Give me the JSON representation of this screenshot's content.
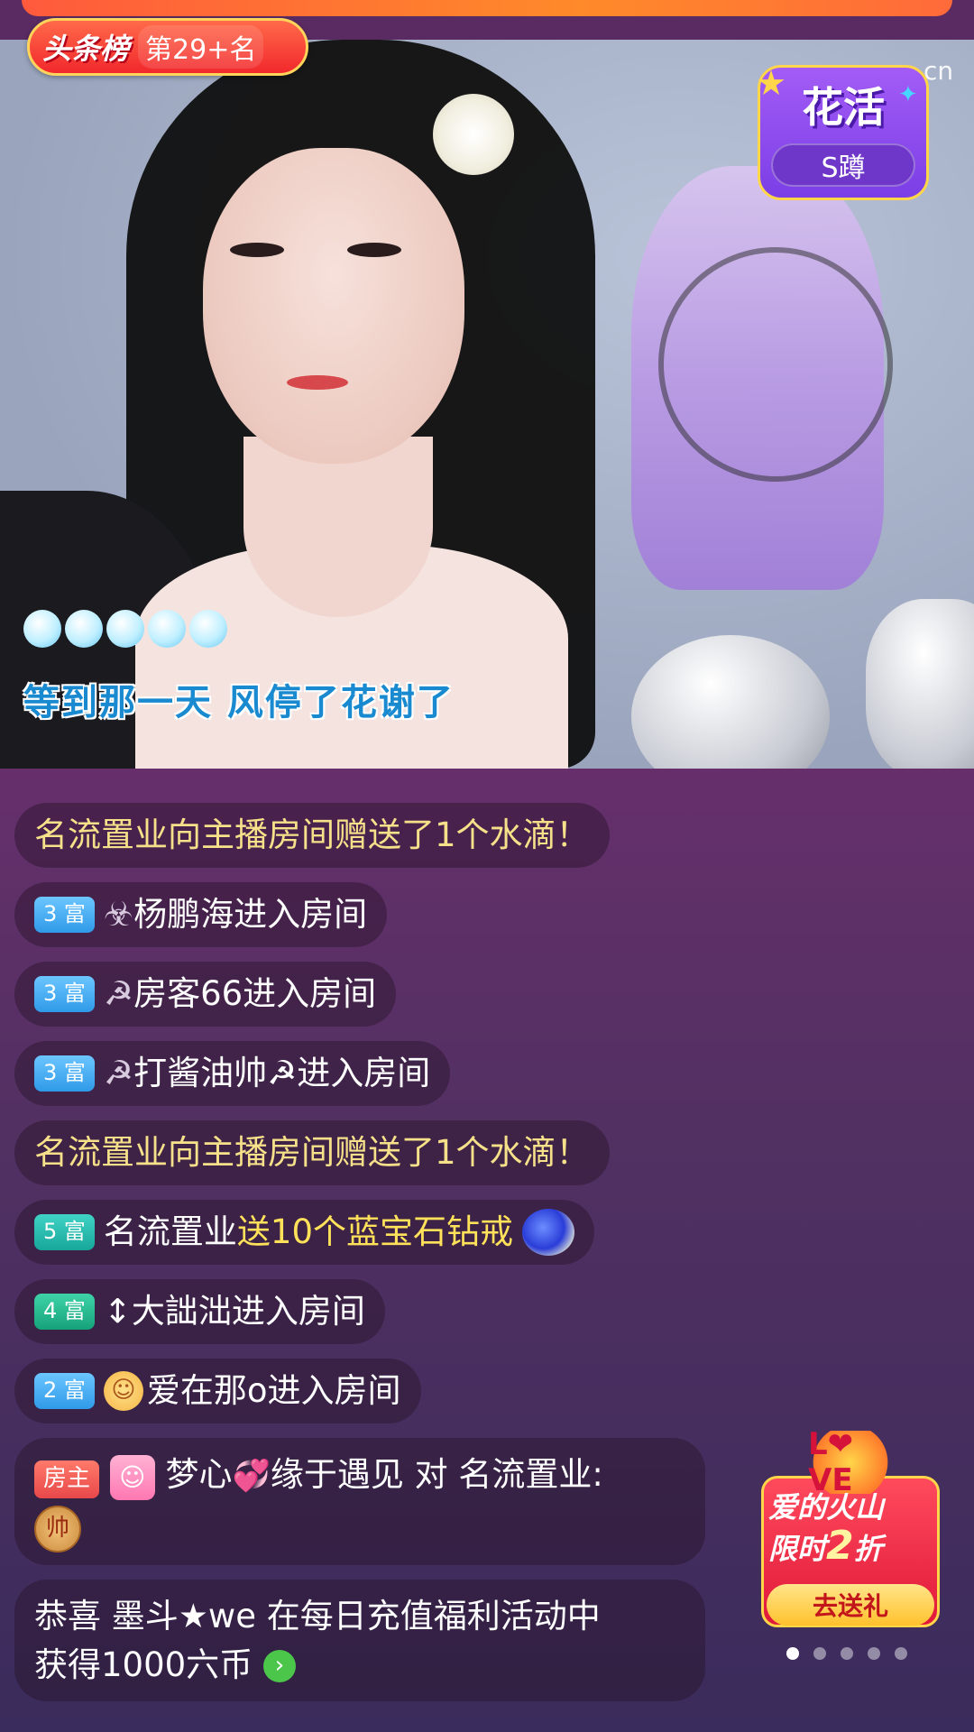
{
  "rank_badge": {
    "board": "头条榜",
    "rank": "第29+名"
  },
  "game_badge": {
    "title": "花活",
    "pill": "S蹲"
  },
  "watermark": "cn",
  "lyrics": "等到那一天 风停了花谢了",
  "chat": {
    "m1": {
      "user": "名流置业",
      "text": " 向主播房间赠送了1个水滴！"
    },
    "m2": {
      "level": "3 富",
      "icon": "☣",
      "user": "杨鹏海",
      "action": " 进入房间"
    },
    "m3": {
      "level": "3 富",
      "icon": "☭",
      "user": "房客66",
      "action": " 进入房间"
    },
    "m4": {
      "level": "3 富",
      "icon": "☭",
      "user": "打酱油帅☭",
      "action": " 进入房间"
    },
    "m5": {
      "user": "名流置业",
      "text": " 向主播房间赠送了1个水滴！"
    },
    "m6": {
      "level": "5 富",
      "user": "名流置业",
      "gift": " 送10个蓝宝石钻戒"
    },
    "m7": {
      "level": "4 富",
      "icon": "↕",
      "user": "大詘泏",
      "action": " 进入房间"
    },
    "m8": {
      "level": "2 富",
      "user": "爱在那o",
      "action": " 进入房间"
    },
    "m9": {
      "badge": "房主",
      "user1": "梦心",
      "user2": "缘于遇见",
      "to": " 对 ",
      "target": "名流置业:",
      "chess": "帅"
    },
    "m10": {
      "line1": "恭喜 墨斗★we  在每日充值福利活动中",
      "line2": "获得1000六币"
    }
  },
  "promo": {
    "crown": "L❤VE",
    "line1": "爱的火山",
    "line2a": "限时",
    "line2b": "2",
    "line2c": "折",
    "button": "去送礼"
  },
  "pager": {
    "count": 5,
    "active": 0
  }
}
